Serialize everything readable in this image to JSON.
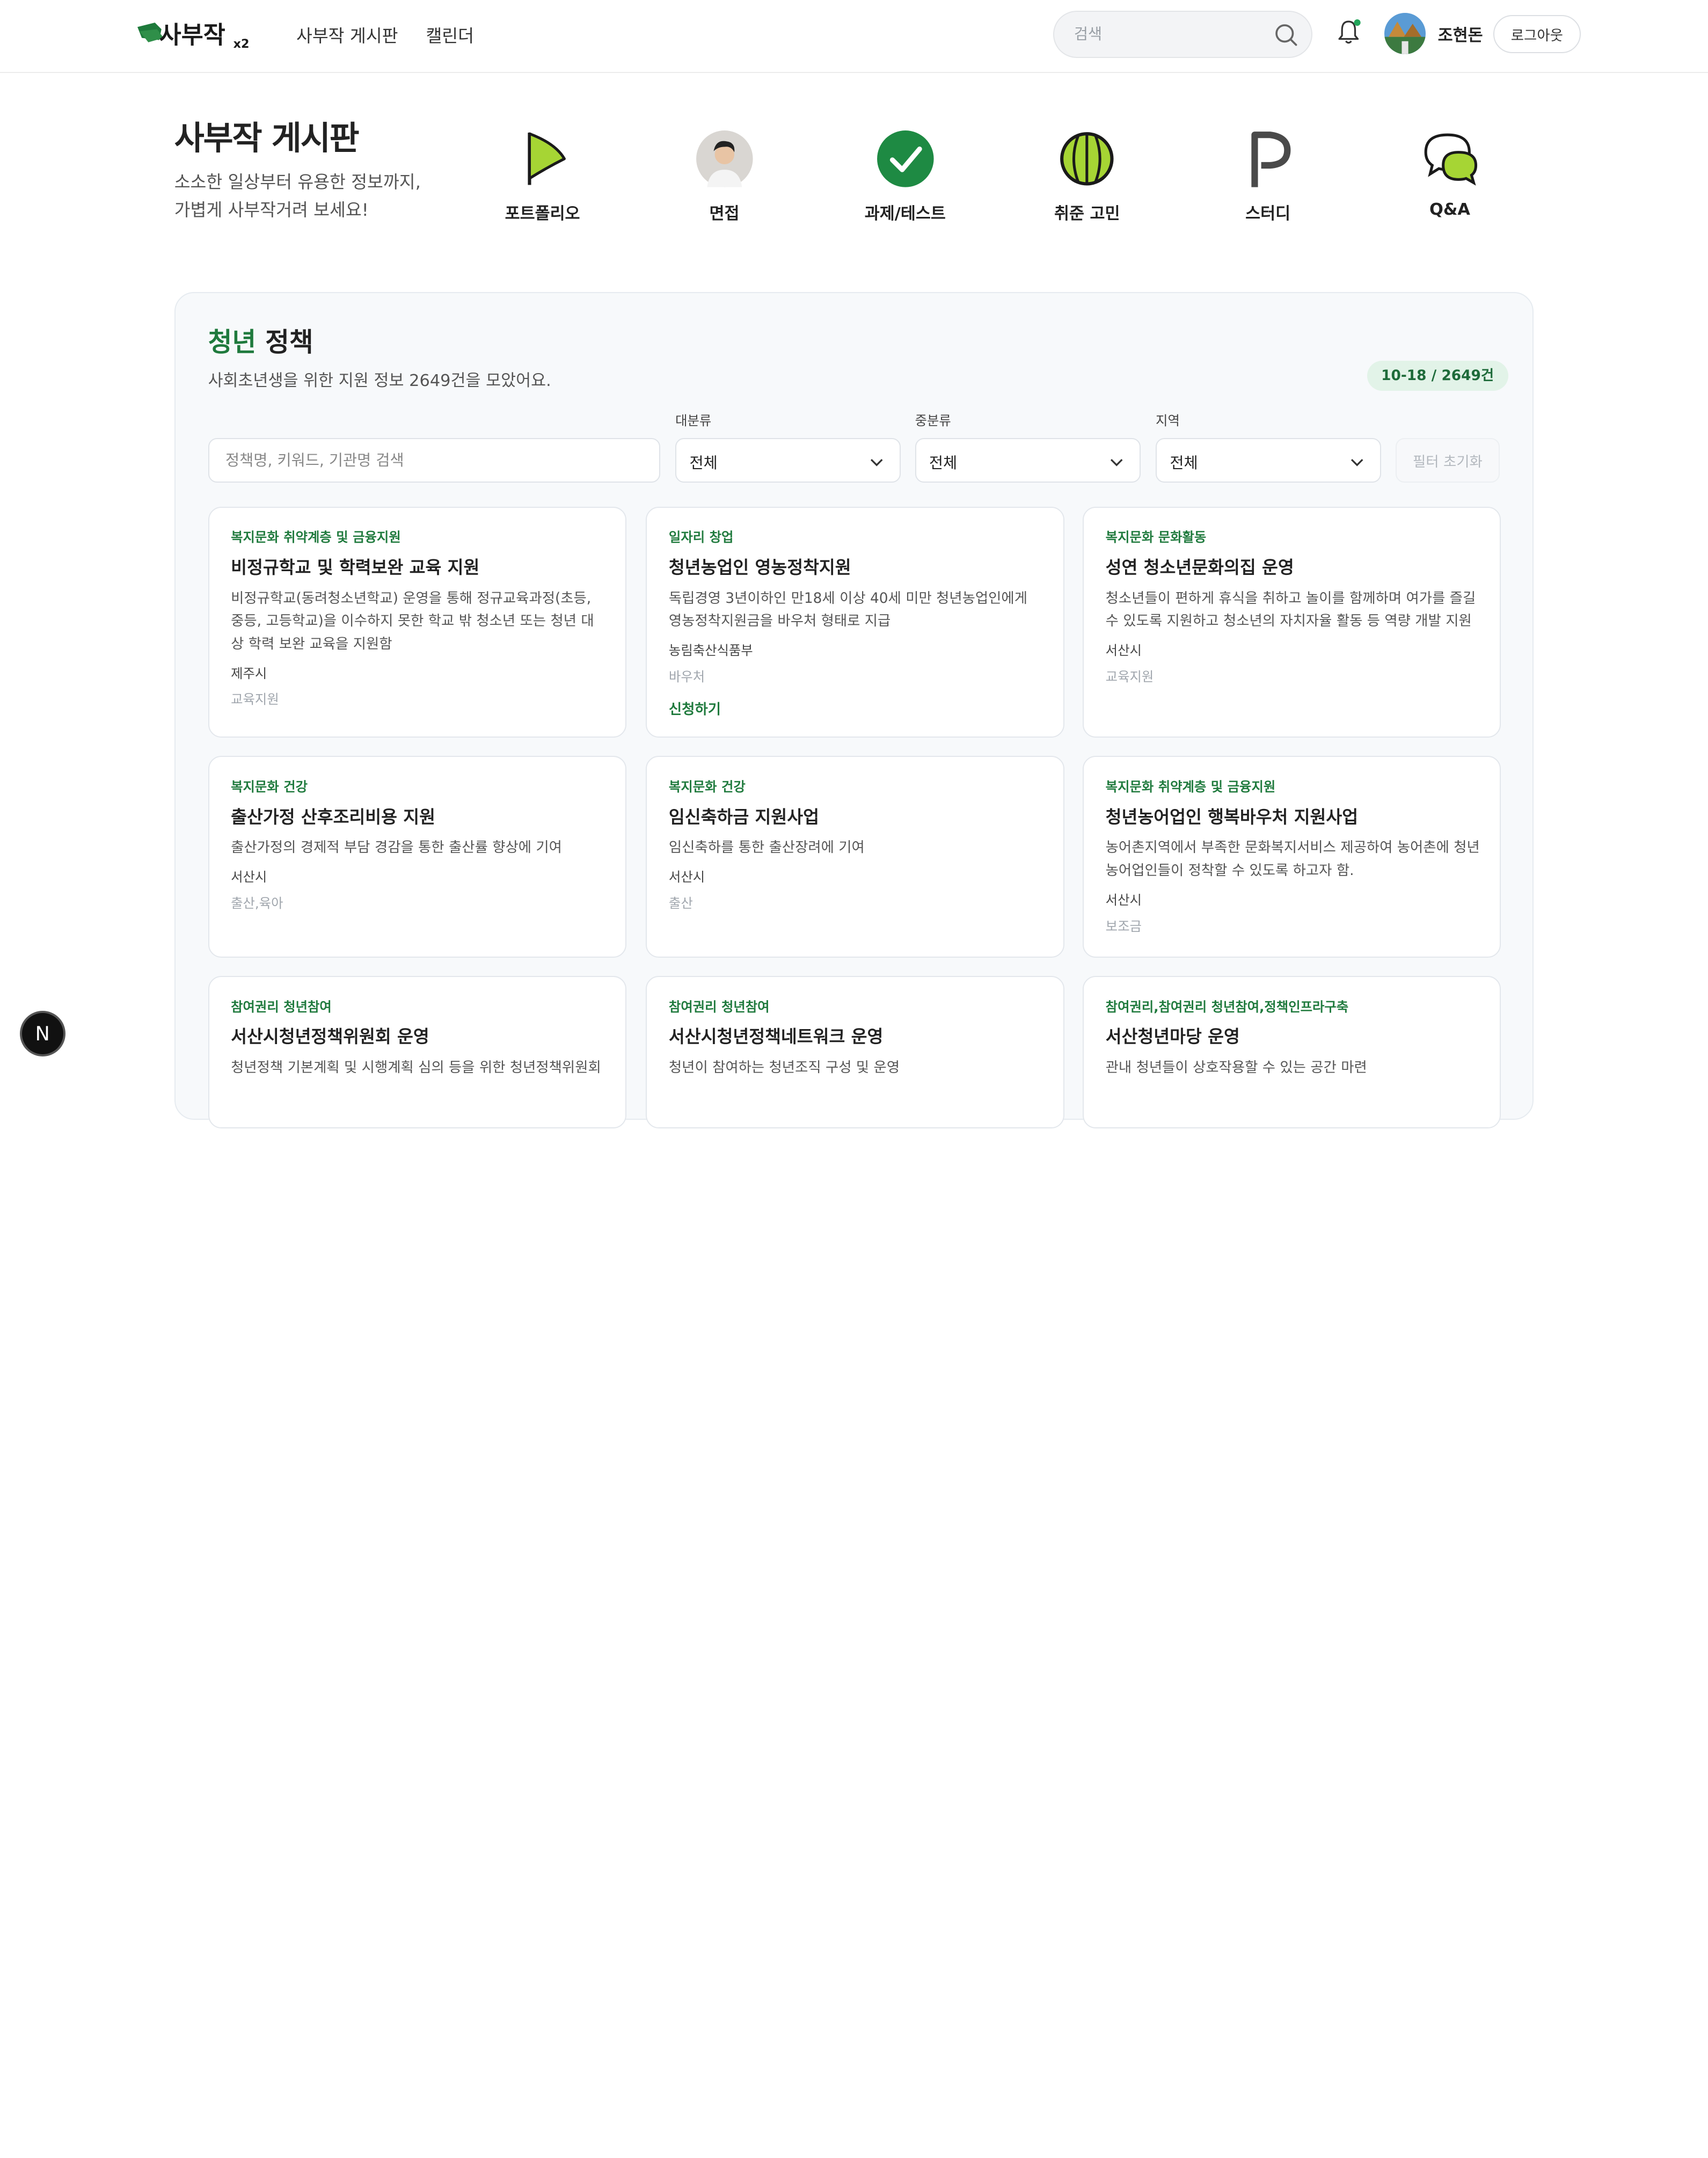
{
  "header": {
    "logo_text": "사부작x2",
    "nav": [
      "사부작 게시판",
      "캘린더"
    ],
    "search_placeholder": "검색",
    "username": "조현돈",
    "logout_label": "로그아웃"
  },
  "board": {
    "title": "사부작 게시판",
    "desc_line1": "소소한 일상부터 유용한 정보까지,",
    "desc_line2": "가볍게 사부작거려 보세요!",
    "categories": [
      {
        "label": "포트폴리오",
        "icon": "flag-icon"
      },
      {
        "label": "면접",
        "icon": "interview-avatar-icon"
      },
      {
        "label": "과제/테스트",
        "icon": "check-circle-icon"
      },
      {
        "label": "취준 고민",
        "icon": "tennis-ball-icon"
      },
      {
        "label": "스터디",
        "icon": "study-p-icon"
      },
      {
        "label": "Q&A",
        "icon": "chat-bubbles-icon"
      }
    ]
  },
  "policy": {
    "title_accent": "청년",
    "title_rest": " 정책",
    "desc": "사회초년생을 위한 지원 정보 2649건을 모았어요.",
    "count": "10-18 / 2649건",
    "filters": {
      "search_placeholder": "정책명, 키워드, 기관명 검색",
      "major_label": "대분류",
      "major_value": "전체",
      "middle_label": "중분류",
      "middle_value": "전체",
      "region_label": "지역",
      "region_value": "전체",
      "reset_label": "필터 초기화"
    },
    "cards": [
      {
        "category": "복지문화 취약계층 및 금융지원",
        "title": "비정규학교 및 학력보완 교육 지원",
        "desc": "비정규학교(동려청소년학교) 운영을 통해 정규교육과정(초등, 중등, 고등학교)을 이수하지 못한 학교 밖 청소년 또는 청년 대상 학력 보완 교육을 지원함",
        "region": "제주시",
        "tag": "교육지원",
        "apply": ""
      },
      {
        "category": "일자리 창업",
        "title": "청년농업인 영농정착지원",
        "desc": "독립경영 3년이하인 만18세 이상 40세 미만 청년농업인에게 영농정착지원금을 바우처 형태로 지급",
        "region": "농림축산식품부",
        "tag": "바우처",
        "apply": "신청하기"
      },
      {
        "category": "복지문화 문화활동",
        "title": "성연 청소년문화의집 운영",
        "desc": "청소년들이 편하게 휴식을 취하고 놀이를 함께하며 여가를 즐길 수 있도록 지원하고 청소년의 자치자율 활동 등 역량 개발 지원",
        "region": "서산시",
        "tag": "교육지원",
        "apply": ""
      },
      {
        "category": "복지문화 건강",
        "title": "출산가정 산후조리비용 지원",
        "desc": "출산가정의 경제적 부담 경감을 통한 출산률 향상에 기여",
        "region": "서산시",
        "tag": "출산,육아",
        "apply": ""
      },
      {
        "category": "복지문화 건강",
        "title": "임신축하금 지원사업",
        "desc": "임신축하를 통한 출산장려에 기여",
        "region": "서산시",
        "tag": "출산",
        "apply": ""
      },
      {
        "category": "복지문화 취약계층 및 금융지원",
        "title": "청년농어업인 행복바우처 지원사업",
        "desc": "농어촌지역에서 부족한 문화복지서비스 제공하여 농어촌에 청년농어업인들이 정착할 수 있도록 하고자 함.",
        "region": "서산시",
        "tag": "보조금",
        "apply": ""
      },
      {
        "category": "참여권리 청년참여",
        "title": "서산시청년정책위원회 운영",
        "desc": "청년정책 기본계획 및 시행계획 심의 등을 위한 청년정책위원회",
        "region": "",
        "tag": "",
        "apply": ""
      },
      {
        "category": "참여권리 청년참여",
        "title": "서산시청년정책네트워크 운영",
        "desc": "청년이 참여하는 청년조직 구성 및 운영",
        "region": "",
        "tag": "",
        "apply": ""
      },
      {
        "category": "참여권리,참여권리 청년참여,정책인프라구축",
        "title": "서산청년마당 운영",
        "desc": "관내 청년들이 상호작용할 수 있는 공간 마련",
        "region": "",
        "tag": "",
        "apply": ""
      }
    ]
  },
  "dev_badge": "N",
  "colors": {
    "accent": "#1f7a3d",
    "lime": "#a6d534"
  }
}
